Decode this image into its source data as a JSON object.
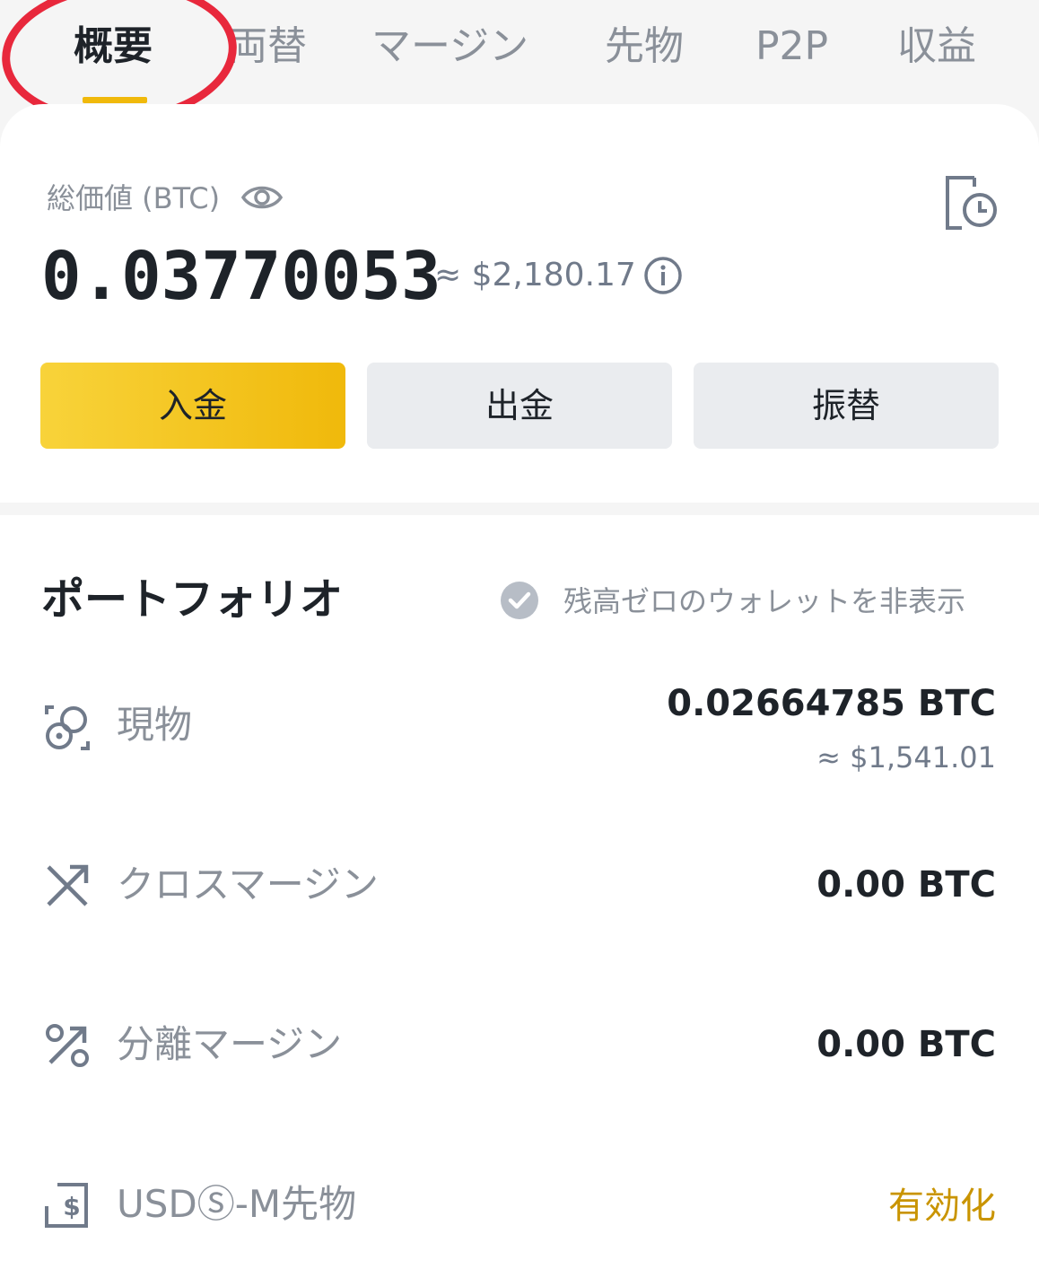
{
  "tabs": [
    {
      "label": "概要",
      "active": true
    },
    {
      "label": "両替",
      "active": false
    },
    {
      "label": "マージン",
      "active": false
    },
    {
      "label": "先物",
      "active": false
    },
    {
      "label": "P2P",
      "active": false
    },
    {
      "label": "収益",
      "active": false
    }
  ],
  "balance": {
    "label": "総価値 (BTC)",
    "value": "0.03770053",
    "usd": "≈ $2,180.17"
  },
  "actions": {
    "deposit": "入金",
    "withdraw": "出金",
    "transfer": "振替"
  },
  "portfolio": {
    "title": "ポートフォリオ",
    "hide_zero_label": "残高ゼロのウォレットを非表示",
    "accounts": [
      {
        "label": "現物",
        "value": "0.02664785 BTC",
        "sub": "≈ $1,541.01",
        "icon": "spot-coins-icon"
      },
      {
        "label": "クロスマージン",
        "value": "0.00 BTC",
        "icon": "cross-margin-icon"
      },
      {
        "label": "分離マージン",
        "value": "0.00 BTC",
        "icon": "isolated-margin-icon"
      },
      {
        "label": "USDⓈ-M先物",
        "action": "有効化",
        "icon": "usd-futures-icon"
      }
    ]
  },
  "colors": {
    "accent": "#f0b90b",
    "annotation": "#e8283c",
    "enable_text": "#c99400"
  }
}
